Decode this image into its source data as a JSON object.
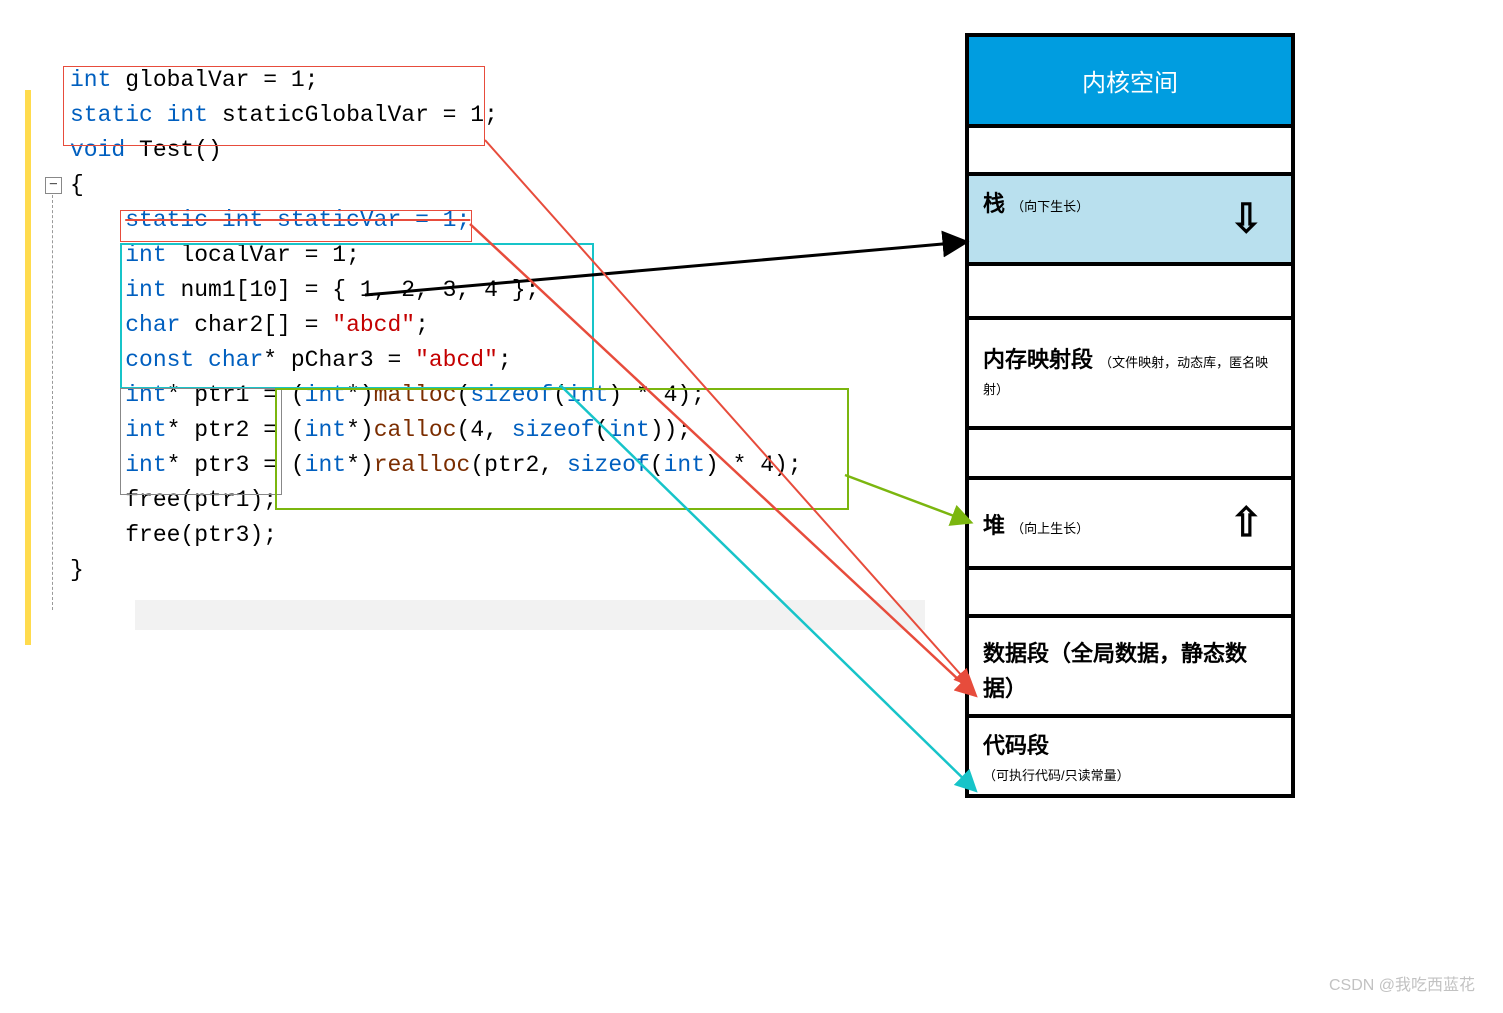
{
  "code": {
    "globals": {
      "line1_kw_int": "int",
      "line1_rest": " globalVar = 1;",
      "line2_kw_static": "static ",
      "line2_kw_int": "int",
      "line2_rest": " staticGlobalVar = 1;"
    },
    "fn_header": {
      "kw_void": "void",
      "name": " Test()",
      "open_brace": "{",
      "close_brace": "}"
    },
    "body": {
      "staticVar": "static int staticVar = 1;",
      "localVar_kw": "int",
      "localVar_rest": " localVar = 1;",
      "num1_kw": "int",
      "num1_rest": " num1[10] = { 1, 2, 3, 4 };",
      "char2_kw": "char",
      "char2_mid": " char2[] = ",
      "char2_str": "\"abcd\"",
      "char2_end": ";",
      "pchar3_kw": "const char",
      "pchar3_mid": "* pChar3 = ",
      "pchar3_str": "\"abcd\"",
      "pchar3_end": ";",
      "ptr1_kw": "int",
      "ptr1_mid": "* ptr1 = (",
      "ptr1_cast": "int",
      "ptr1_call_a": "*)",
      "ptr1_fn": "malloc",
      "ptr1_args_a": "(",
      "ptr1_sizeof": "sizeof",
      "ptr1_args_b": "(",
      "ptr1_sizeof_t": "int",
      "ptr1_args_c": ") * 4);",
      "ptr2_kw": "int",
      "ptr2_mid": "* ptr2 = (",
      "ptr2_cast": "int",
      "ptr2_call_a": "*)",
      "ptr2_fn": "calloc",
      "ptr2_args_a": "(4, ",
      "ptr2_sizeof": "sizeof",
      "ptr2_args_b": "(",
      "ptr2_sizeof_t": "int",
      "ptr2_args_c": "));",
      "ptr3_kw": "int",
      "ptr3_mid": "* ptr3 = (",
      "ptr3_cast": "int",
      "ptr3_call_a": "*)",
      "ptr3_fn": "realloc",
      "ptr3_args_a": "(ptr2, ",
      "ptr3_sizeof": "sizeof",
      "ptr3_args_b": "(",
      "ptr3_sizeof_t": "int",
      "ptr3_args_c": ") * 4);",
      "free1": "free(ptr1);",
      "free3": "free(ptr3);"
    },
    "fold_glyph": "−"
  },
  "memory": {
    "kernel": "内核空间",
    "stack_label": "栈",
    "stack_note": "（向下生长）",
    "mmap_label": "内存映射段",
    "mmap_note": "（文件映射，动态库，匿名映射）",
    "heap_label": "堆",
    "heap_note": "（向上生长）",
    "data_label": "数据段（全局数据，静态数据）",
    "code_label": "代码段",
    "code_note": "（可执行代码/只读常量）",
    "arrow_down": "⇩",
    "arrow_up": "⇧"
  },
  "watermark": "CSDN @我吃西蓝花",
  "colors": {
    "red_box": "#e74c3c",
    "cyan_box": "#17c4c9",
    "green_box": "#7bb60f",
    "kernel_bg": "#009de0",
    "stack_bg": "#b9e0ee"
  }
}
